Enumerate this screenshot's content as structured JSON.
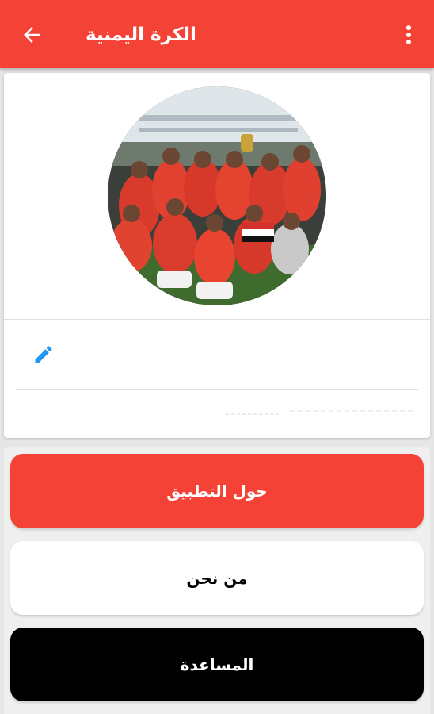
{
  "app_bar": {
    "title": "الكرة اليمنية",
    "back_icon": "arrow-left-icon",
    "menu_icon": "more-vert-icon",
    "background_color": "#f44336"
  },
  "profile": {
    "photo_alt": "team-celebration-photo",
    "edit_icon": "pencil-icon",
    "edit_icon_color": "#2196f3"
  },
  "menu": {
    "about_label": "حول التطبيق",
    "who_label": "من نحن",
    "help_label": "المساعدة",
    "about_color": "#f44336",
    "who_color": "#ffffff",
    "help_color": "#000000"
  }
}
